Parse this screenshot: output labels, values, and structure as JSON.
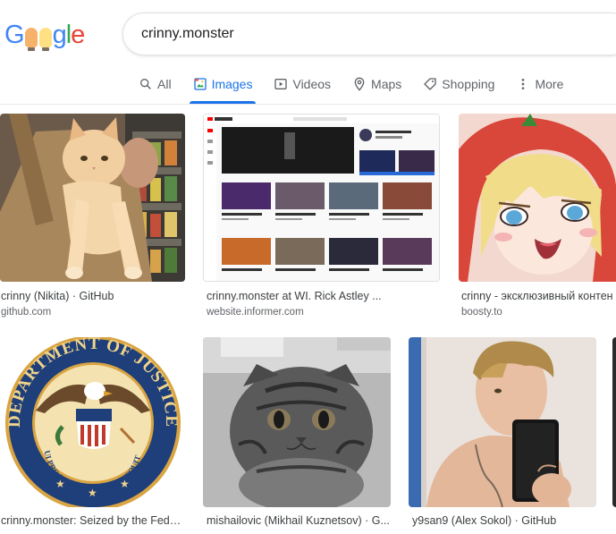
{
  "logo": {
    "letters": [
      "G",
      "o",
      "o",
      "g",
      "l",
      "e"
    ],
    "colors": [
      "#4285f4",
      "#ea4335",
      "#fbbc05",
      "#4285f4",
      "#34a853",
      "#ea4335"
    ]
  },
  "search": {
    "query": "crinny.monster"
  },
  "tabs": [
    {
      "label": "All",
      "icon": "search-icon",
      "active": false
    },
    {
      "label": "Images",
      "icon": "image-icon",
      "active": true
    },
    {
      "label": "Videos",
      "icon": "play-icon",
      "active": false
    },
    {
      "label": "Maps",
      "icon": "map-pin-icon",
      "active": false
    },
    {
      "label": "Shopping",
      "icon": "tag-icon",
      "active": false
    },
    {
      "label": "More",
      "icon": "more-vert-icon",
      "active": false
    }
  ],
  "results": [
    {
      "title": "crinny (Nikita) · GitHub",
      "source": "github.com",
      "image": "orange cat in shopping bag"
    },
    {
      "title": "crinny.monster at WI. Rick Astley ...",
      "source": "website.informer.com",
      "image": "youtube page screenshot"
    },
    {
      "title": "crinny - эксклюзивный контен",
      "source": "boosty.to",
      "image": "anime girl with tomato hood"
    },
    {
      "title": "crinny.monster: Seized by the Fede...",
      "source": "",
      "image": "department of justice seal"
    },
    {
      "title": "mishailovic (Mikhail Kuznetsov) · G...",
      "source": "",
      "image": "grey scottish fold cat"
    },
    {
      "title": "y9san9 (Alex Sokol) · GitHub",
      "source": "",
      "image": "person mirror selfie"
    }
  ],
  "seal": {
    "outer_text": "DEPARTMENT OF JUSTICE",
    "motto": "QUI PRO DOMINA JUSTITIA SEQUITUR"
  },
  "accent_color": "#1a73e8"
}
